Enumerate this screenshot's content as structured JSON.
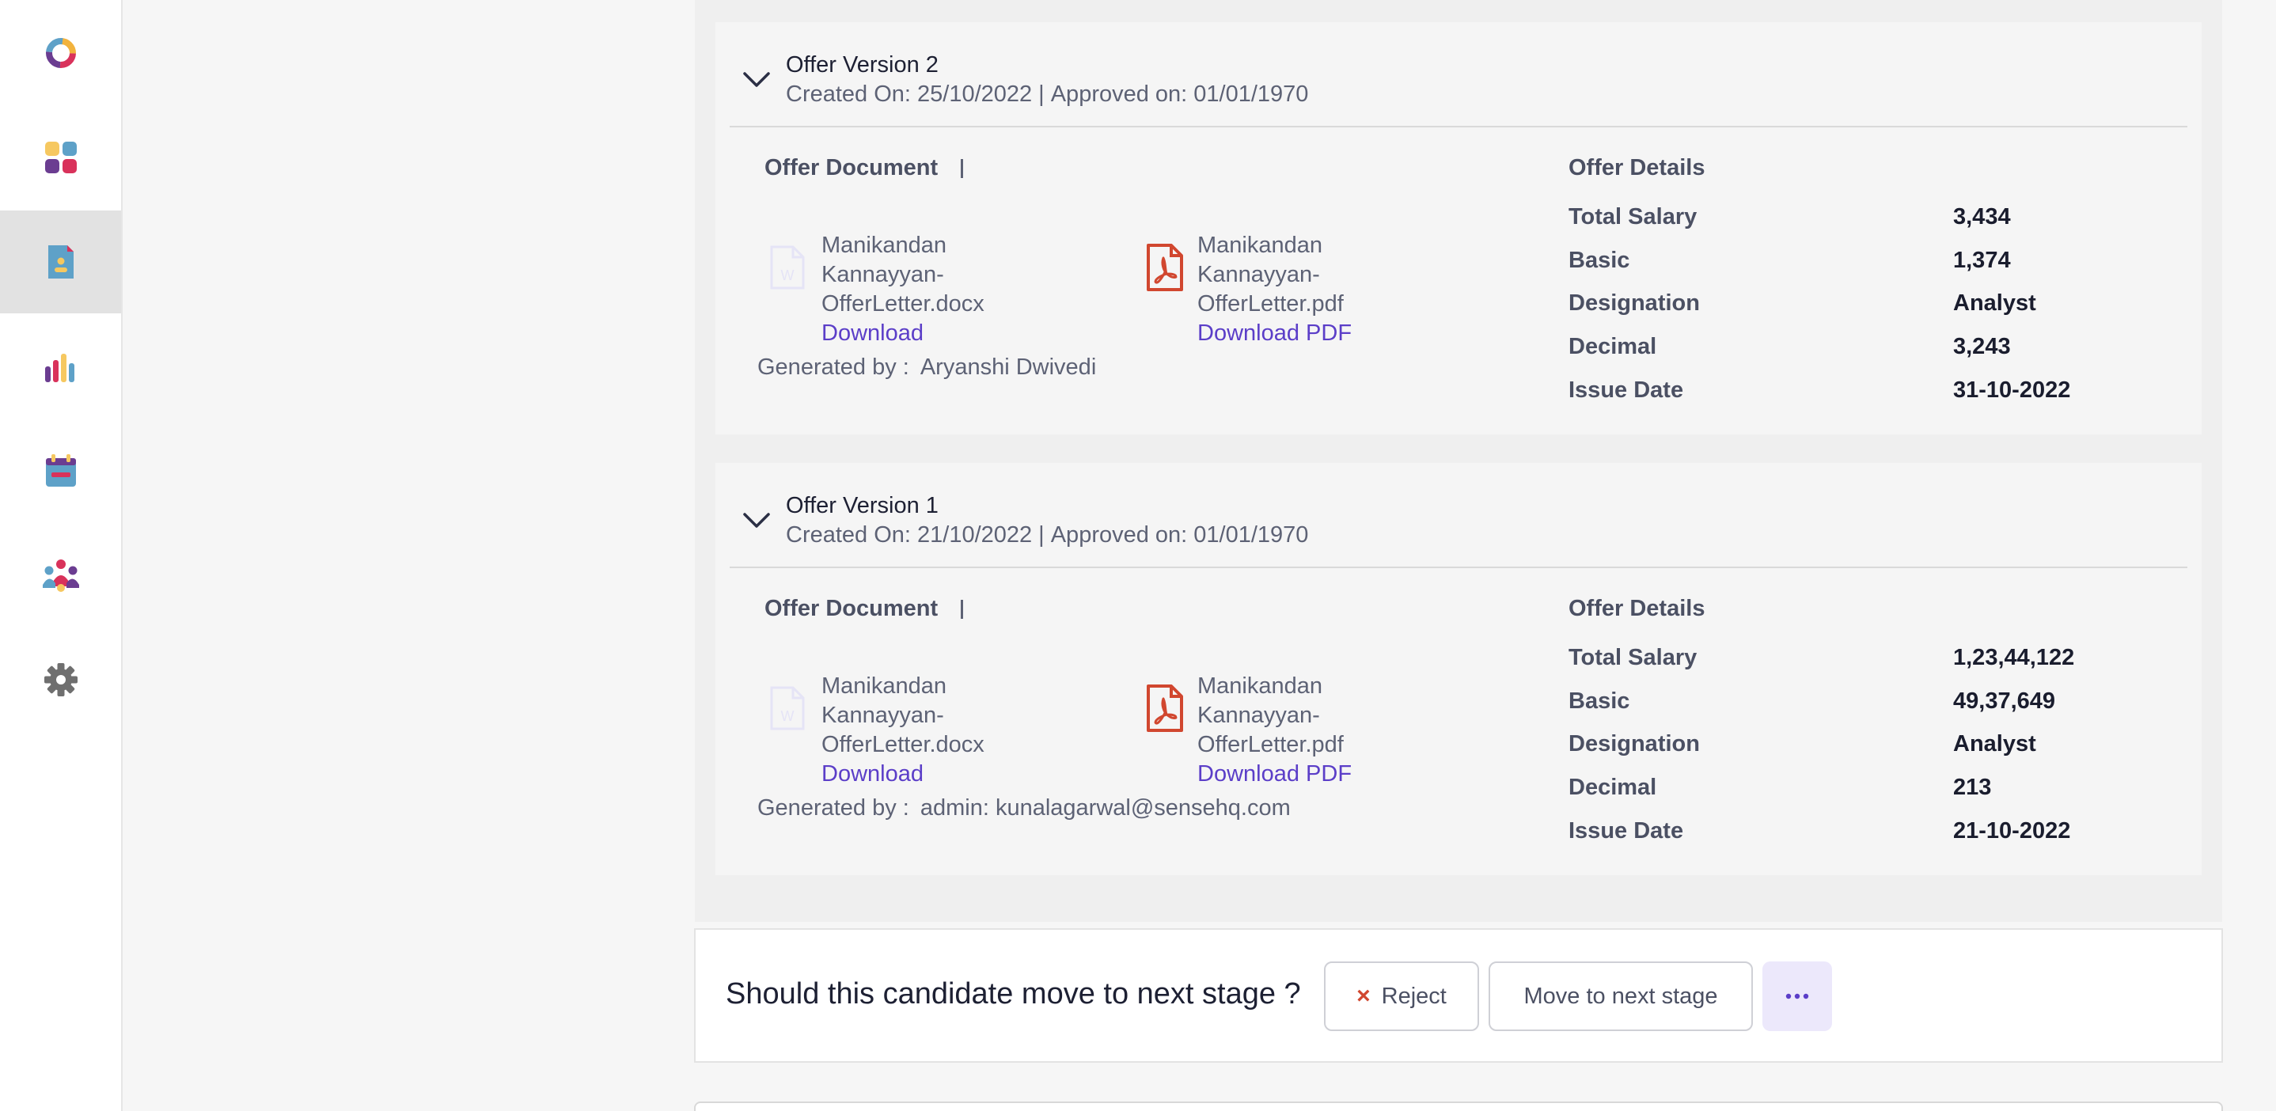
{
  "sidebar": {
    "items": [
      {
        "icon": "logo-ring-icon",
        "active": false
      },
      {
        "icon": "apps-grid-icon",
        "active": false
      },
      {
        "icon": "candidate-document-icon",
        "active": true
      },
      {
        "icon": "bar-chart-icon",
        "active": false
      },
      {
        "icon": "calendar-icon",
        "active": false
      },
      {
        "icon": "team-icon",
        "active": false
      },
      {
        "icon": "settings-gear-icon",
        "active": false
      }
    ]
  },
  "offers": [
    {
      "title": "Offer Version 2",
      "created": "Created On: 25/10/2022",
      "separator": "|",
      "approved": "Approved on: 01/01/1970",
      "doc_section_title": "Offer Document",
      "files": [
        {
          "type": "docx",
          "name": "Manikandan\nKannayyan-\nOfferLetter.docx",
          "link": "Download"
        },
        {
          "type": "pdf",
          "name": "Manikandan\nKannayyan-\nOfferLetter.pdf",
          "link": "Download PDF"
        }
      ],
      "generated_label": "Generated by :",
      "generated_by": "Aryanshi Dwivedi",
      "details_title": "Offer Details",
      "details": [
        {
          "label": "Total Salary",
          "value": "3,434"
        },
        {
          "label": "Basic",
          "value": "1,374"
        },
        {
          "label": "Designation",
          "value": "Analyst"
        },
        {
          "label": "Decimal",
          "value": "3,243"
        },
        {
          "label": "Issue Date",
          "value": "31-10-2022"
        }
      ]
    },
    {
      "title": "Offer Version 1",
      "created": "Created On: 21/10/2022",
      "separator": "|",
      "approved": "Approved on: 01/01/1970",
      "doc_section_title": "Offer Document",
      "files": [
        {
          "type": "docx",
          "name": "Manikandan\nKannayyan-\nOfferLetter.docx",
          "link": "Download"
        },
        {
          "type": "pdf",
          "name": "Manikandan\nKannayyan-\nOfferLetter.pdf",
          "link": "Download PDF"
        }
      ],
      "generated_label": "Generated by :",
      "generated_by": "admin: kunalagarwal@sensehq.com",
      "details_title": "Offer Details",
      "details": [
        {
          "label": "Total Salary",
          "value": "1,23,44,122"
        },
        {
          "label": "Basic",
          "value": "49,37,649"
        },
        {
          "label": "Designation",
          "value": "Analyst"
        },
        {
          "label": "Decimal",
          "value": "213"
        },
        {
          "label": "Issue Date",
          "value": "21-10-2022"
        }
      ]
    }
  ],
  "action_bar": {
    "question": "Should this candidate move to next stage ?",
    "reject_icon": "×",
    "reject_label": "Reject",
    "next_label": "Move to next stage",
    "more_icon": "more-horizontal-icon"
  },
  "colors": {
    "accent": "#5b3ec8",
    "pdf_red": "#d1472f",
    "sidebar_active": "#e2e2e2"
  }
}
